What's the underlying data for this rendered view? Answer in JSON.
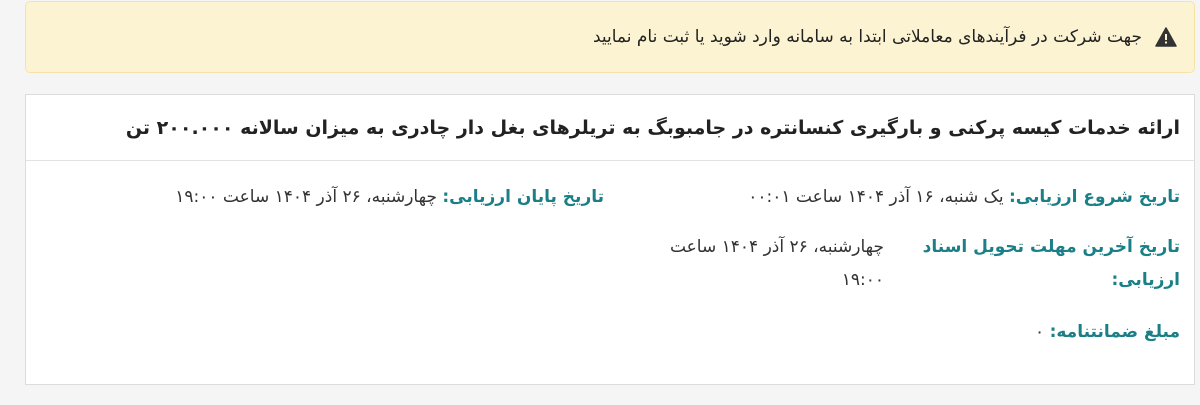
{
  "alert": {
    "message": "جهت شرکت در فرآیندهای معاملاتی ابتدا به سامانه وارد شوید یا ثبت نام نمایید",
    "icon": "warning-triangle-icon"
  },
  "tender": {
    "title": "ارائه خدمات کیسه پرکنی و بارگیری کنسانتره در جامبوبگ به تریلرهای بغل دار چادری به میزان سالانه ۲۰۰.۰۰۰ تن",
    "start_label": "تاریخ شروع ارزیابی:",
    "start_value": "یک شنبه، ۱۶ آذر ۱۴۰۴ ساعت ۰۰:۰۱",
    "end_label": "تاریخ پایان ارزیابی:",
    "end_value": "چهارشنبه، ۲۶ آذر ۱۴۰۴ ساعت ۱۹:۰۰",
    "deadline_label": "تاریخ آخرین مهلت تحویل اسناد ارزیابی:",
    "deadline_value": "چهارشنبه، ۲۶ آذر ۱۴۰۴ ساعت ۱۹:۰۰",
    "guarantee_label": "مبلغ ضمانتنامه:",
    "guarantee_value": "۰"
  }
}
